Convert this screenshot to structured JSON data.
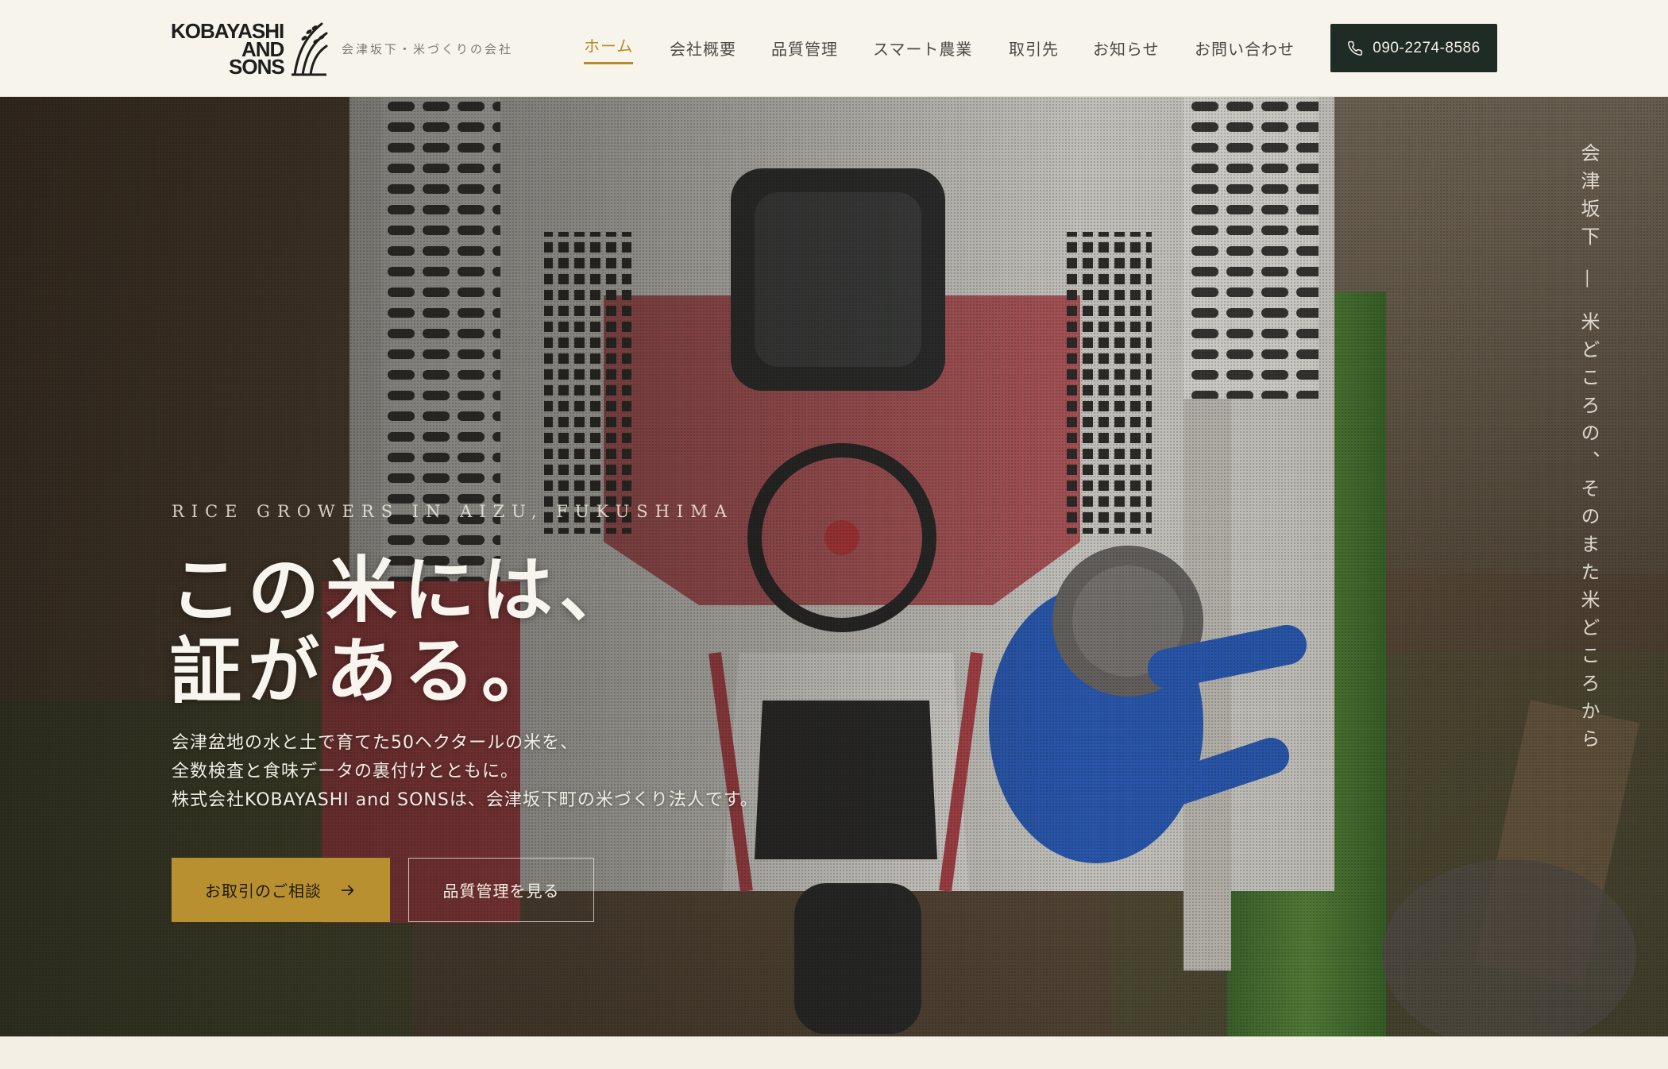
{
  "header": {
    "logo": {
      "line1": "KOBAYASHI",
      "line2": "AND",
      "line3": "SONS"
    },
    "tagline": "会津坂下・米づくりの会社",
    "nav": [
      {
        "label": "ホーム",
        "active": true
      },
      {
        "label": "会社概要"
      },
      {
        "label": "品質管理"
      },
      {
        "label": "スマート農業"
      },
      {
        "label": "取引先"
      },
      {
        "label": "お知らせ"
      },
      {
        "label": "お問い合わせ"
      }
    ],
    "phone": {
      "icon": "phone-icon",
      "number": "090-2274-8586"
    }
  },
  "hero": {
    "eyebrow": "RICE GROWERS IN AIZU, FUKUSHIMA",
    "title_line1": "この米には、",
    "title_line2": "証がある。",
    "lead_line1": "会津盆地の水と土で育てた50ヘクタールの米を、",
    "lead_line2": "全数検査と食味データの裏付けとともに。",
    "lead_line3": "株式会社KOBAYASHI and SONSは、会津坂下町の米づくり法人です。",
    "cta_primary": "お取引のご相談",
    "cta_primary_icon": "arrow-right-icon",
    "cta_secondary": "品質管理を見る",
    "vertical_copy": "会津坂下 — 米どころの、そのまた米どころから"
  },
  "colors": {
    "accent_gold": "#b8902f",
    "nav_active": "#b88b2a",
    "dark_button": "#1f2b25",
    "page_background": "#f3efe4"
  }
}
